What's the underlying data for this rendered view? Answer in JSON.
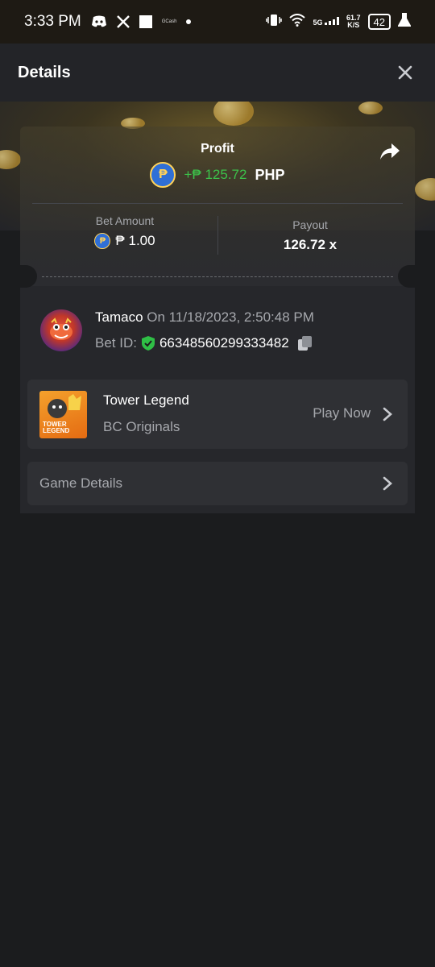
{
  "status_bar": {
    "time": "3:33 PM",
    "gcash_label": "GCash",
    "network": "5G",
    "speed_value": "61.7",
    "speed_unit": "K/S",
    "battery": "42"
  },
  "header": {
    "title": "Details"
  },
  "profit": {
    "label": "Profit",
    "currency_symbol": "₱",
    "value": "+₱ 125.72",
    "currency": "PHP"
  },
  "bet_amount": {
    "label": "Bet Amount",
    "value": "₱ 1.00"
  },
  "payout": {
    "label": "Payout",
    "value": "126.72 x"
  },
  "bet_info": {
    "username": "Tamaco",
    "timestamp": "On 11/18/2023, 2:50:48 PM",
    "bet_id_label": "Bet ID:",
    "bet_id": "66348560299333482"
  },
  "game": {
    "title": "Tower Legend",
    "provider": "BC Originals",
    "play_label": "Play Now",
    "thumb_text": "TOWER LEGEND"
  },
  "game_details_label": "Game Details",
  "colors": {
    "profit_green": "#3cc24a",
    "coin_blue": "#2f6fd6",
    "gold": "#ffd25a"
  }
}
